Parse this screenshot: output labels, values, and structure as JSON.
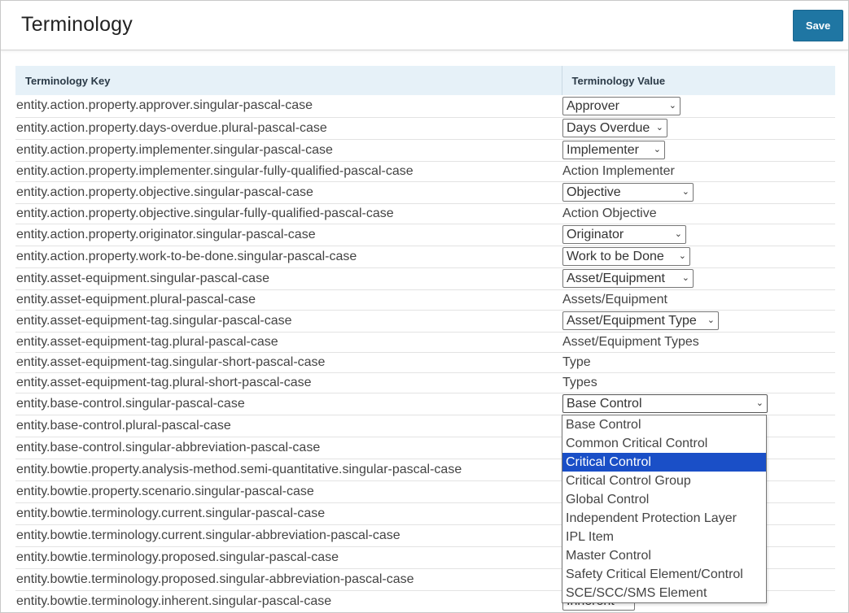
{
  "header": {
    "title": "Terminology",
    "save_label": "Save"
  },
  "table": {
    "headers": {
      "key": "Terminology Key",
      "value": "Terminology Value"
    },
    "rows": [
      {
        "key": "entity.action.property.approver.singular-pascal-case",
        "value": "Approver",
        "type": "select",
        "w": 145,
        "h": 27
      },
      {
        "key": "entity.action.property.days-overdue.plural-pascal-case",
        "value": "Days Overdue",
        "type": "select",
        "w": 129,
        "h": 27
      },
      {
        "key": "entity.action.property.implementer.singular-pascal-case",
        "value": "Implementer",
        "type": "select",
        "w": 126,
        "h": 27
      },
      {
        "key": "entity.action.property.implementer.singular-fully-qualified-pascal-case",
        "value": "Action Implementer",
        "type": "text",
        "h": 25
      },
      {
        "key": "entity.action.property.objective.singular-pascal-case",
        "value": "Objective",
        "type": "select",
        "w": 161,
        "h": 27
      },
      {
        "key": "entity.action.property.objective.singular-fully-qualified-pascal-case",
        "value": "Action Objective",
        "type": "text",
        "h": 25
      },
      {
        "key": "entity.action.property.originator.singular-pascal-case",
        "value": "Originator",
        "type": "select",
        "w": 152,
        "h": 27
      },
      {
        "key": "entity.action.property.work-to-be-done.singular-pascal-case",
        "value": "Work to be Done",
        "type": "select",
        "w": 157,
        "h": 27
      },
      {
        "key": "entity.asset-equipment.singular-pascal-case",
        "value": "Asset/Equipment",
        "type": "select",
        "w": 161,
        "h": 27
      },
      {
        "key": "entity.asset-equipment.plural-pascal-case",
        "value": "Assets/Equipment",
        "type": "text",
        "h": 25
      },
      {
        "key": "entity.asset-equipment-tag.singular-pascal-case",
        "value": "Asset/Equipment Type",
        "type": "select",
        "w": 192,
        "h": 27
      },
      {
        "key": "entity.asset-equipment-tag.plural-pascal-case",
        "value": "Asset/Equipment Types",
        "type": "text",
        "h": 25
      },
      {
        "key": "entity.asset-equipment-tag.singular-short-pascal-case",
        "value": "Type",
        "type": "text",
        "h": 25
      },
      {
        "key": "entity.asset-equipment-tag.plural-short-pascal-case",
        "value": "Types",
        "type": "text",
        "h": 25
      },
      {
        "key": "entity.base-control.singular-pascal-case",
        "value": "Base Control",
        "type": "select-open",
        "w": 252,
        "h": 27
      },
      {
        "key": "entity.base-control.plural-pascal-case",
        "value": "",
        "type": "covered",
        "h": 27
      },
      {
        "key": "entity.base-control.singular-abbreviation-pascal-case",
        "value": "",
        "type": "covered",
        "h": 27
      },
      {
        "key": "entity.bowtie.property.analysis-method.semi-quantitative.singular-pascal-case",
        "value": "",
        "type": "covered",
        "h": 27
      },
      {
        "key": "entity.bowtie.property.scenario.singular-pascal-case",
        "value": "",
        "type": "covered",
        "h": 27
      },
      {
        "key": "entity.bowtie.terminology.current.singular-pascal-case",
        "value": "",
        "type": "covered",
        "h": 27
      },
      {
        "key": "entity.bowtie.terminology.current.singular-abbreviation-pascal-case",
        "value": "",
        "type": "covered",
        "h": 27
      },
      {
        "key": "entity.bowtie.terminology.proposed.singular-pascal-case",
        "value": "",
        "type": "covered",
        "h": 27
      },
      {
        "key": "entity.bowtie.terminology.proposed.singular-abbreviation-pascal-case",
        "value": "",
        "type": "covered",
        "h": 27
      },
      {
        "key": "entity.bowtie.terminology.inherent.singular-pascal-case",
        "value": "Inherent",
        "type": "select",
        "w": 89,
        "h": 27
      }
    ]
  },
  "dropdown": {
    "options": [
      "Base Control",
      "Common Critical Control",
      "Critical Control",
      "Critical Control Group",
      "Global Control",
      "Independent Protection Layer",
      "IPL Item",
      "Master Control",
      "Safety Critical Element/Control",
      "SCE/SCC/SMS Element"
    ],
    "highlighted_index": 2
  },
  "colors": {
    "accent": "#1f76a3",
    "header_bg": "#e6f1f8",
    "highlight": "#1a4fc7"
  },
  "icons": {
    "select_arrow": "chevron-down-icon"
  }
}
